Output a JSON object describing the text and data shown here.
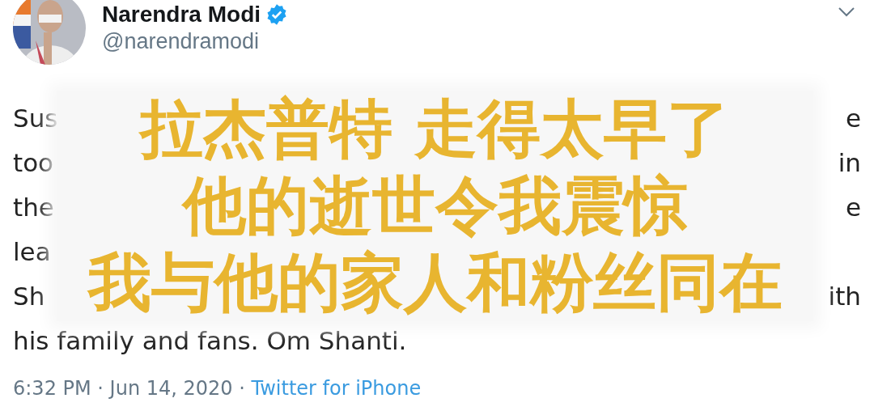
{
  "tweet": {
    "author": {
      "name": "Narendra Modi",
      "verified": true,
      "handle": "@narendramodi"
    },
    "text_lines": [
      {
        "left": "Sus",
        "right": "e"
      },
      {
        "left": "too",
        "right": "in"
      },
      {
        "left": "the",
        "right": "e"
      },
      {
        "left": "lea"
      },
      {
        "left": "Sh",
        "right": "ith"
      },
      {
        "left": "his family and fans. Om Shanti."
      }
    ],
    "timestamp": "6:32 PM · Jun 14, 2020 · ",
    "source": "Twitter for iPhone"
  },
  "caption": {
    "lines": [
      "拉杰普特 走得太早了",
      "他的逝世令我震惊",
      "我与他的家人和粉丝同在"
    ]
  }
}
